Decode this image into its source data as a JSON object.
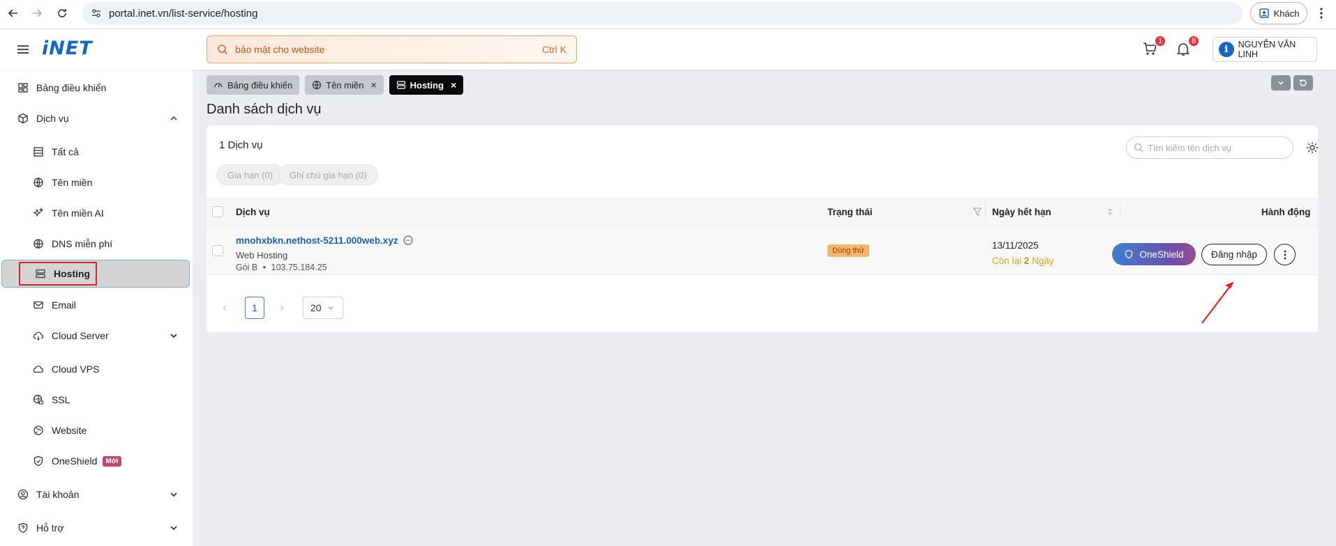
{
  "browser": {
    "url": "portal.inet.vn/list-service/hosting",
    "guest_label": "Khách"
  },
  "header": {
    "logo": "iNET",
    "search_placeholder": "bảo mật cho website",
    "search_shortcut": "Ctrl K",
    "cart_count": "1",
    "notification_count": "8",
    "user_name": "NGUYỄN VĂN LINH"
  },
  "sidebar": {
    "dashboard": "Bảng điều khiển",
    "services": "Dịch vụ",
    "sub": {
      "all": "Tất cả",
      "domain": "Tên miền",
      "domain_ai": "Tên miền AI",
      "dns_free": "DNS miễn phí",
      "hosting": "Hosting",
      "email": "Email",
      "cloud_server": "Cloud Server",
      "cloud_vps": "Cloud VPS",
      "ssl": "SSL",
      "website": "Website",
      "oneshield": "OneShield",
      "new_tag": "Mới"
    },
    "account": "Tài khoản",
    "support": "Hỗ trợ"
  },
  "tabs": [
    {
      "label": "Bảng điều khiển"
    },
    {
      "label": "Tên miền"
    },
    {
      "label": "Hosting"
    }
  ],
  "page": {
    "title": "Danh sách dịch vụ",
    "count": "1 Dịch vụ",
    "search_placeholder": "Tìm kiếm tên dịch vụ",
    "filter_renew": "Gia hạn (0)",
    "filter_renew_note": "Ghi chú gia hạn (0)"
  },
  "table": {
    "headers": {
      "service": "Dịch vụ",
      "status": "Trạng thái",
      "expiry": "Ngày hết hạn",
      "actions": "Hành động"
    },
    "rows": [
      {
        "name": "mnohxbkn.nethost-5211.000web.xyz",
        "type": "Web Hosting",
        "plan": "Gói B",
        "ip": "103.75.184.25",
        "status": "Dùng thử",
        "expiry_date": "13/11/2025",
        "remaining_prefix": "Còn lại",
        "remaining_days": "2",
        "remaining_suffix": "Ngày",
        "oneshield_label": "OneShield",
        "login_label": "Đăng nhập"
      }
    ]
  },
  "pagination": {
    "current_page": "1",
    "page_size": "20"
  },
  "colors": {
    "brand": "#1466c9",
    "accent_orange": "#f5a262",
    "annotation_red": "#e02222"
  }
}
